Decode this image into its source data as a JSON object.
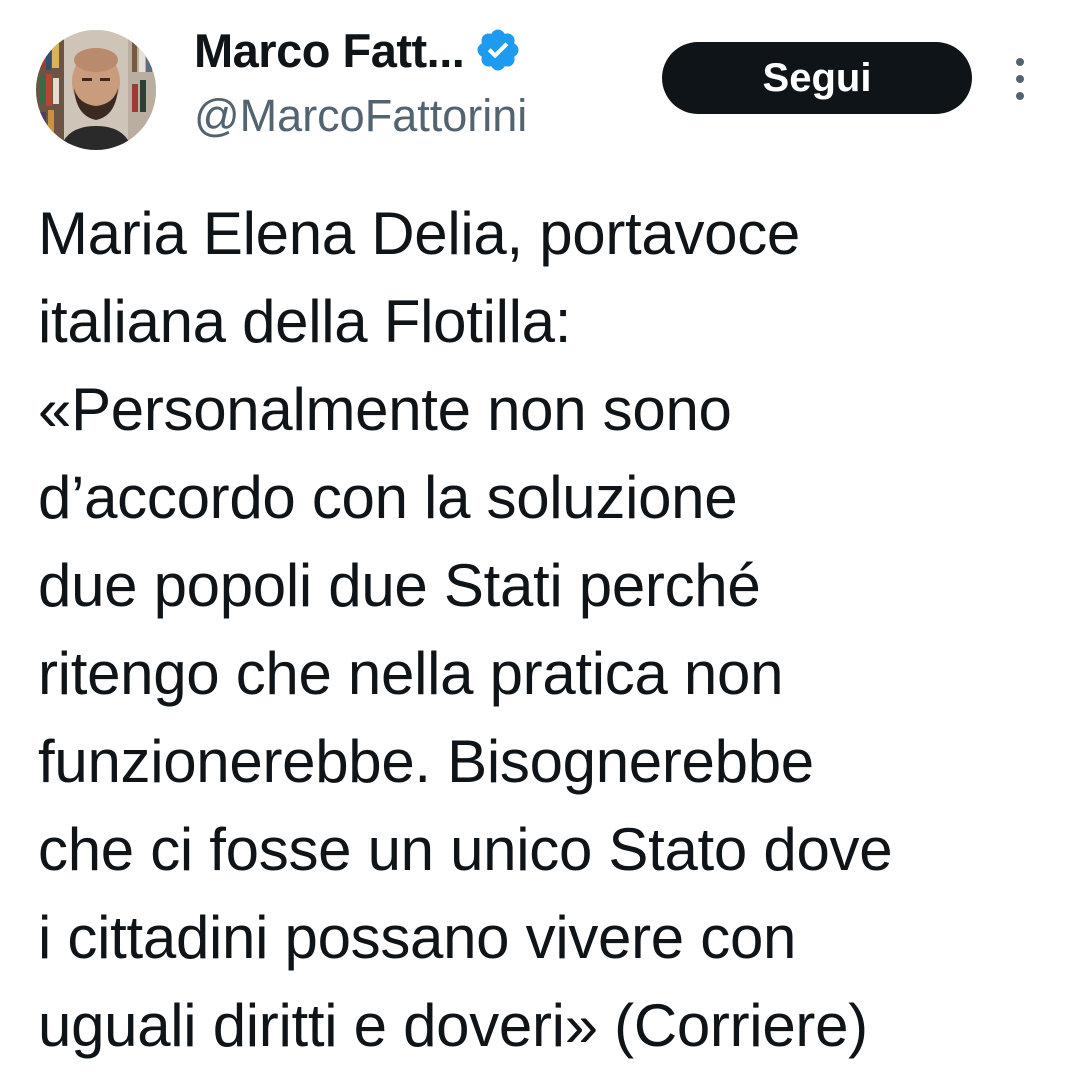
{
  "author": {
    "display_name": "Marco Fatt...",
    "handle": "@MarcoFattorini",
    "avatar_icon": "user-photo",
    "verified_icon": "verified-badge-icon"
  },
  "actions": {
    "follow_label": "Segui",
    "more_icon": "vertical-ellipsis-icon"
  },
  "tweet": {
    "lines": [
      "Maria Elena Delia, portavoce",
      "italiana della Flotilla:",
      "«Personalmente non sono",
      "d’accordo con la soluzione",
      "due popoli due Stati perché",
      "ritengo che nella pratica non",
      "funzionerebbe. Bisognerebbe",
      "che ci fosse un unico Stato dove",
      "i cittadini possano vivere con",
      "uguali diritti e doveri» (Corriere)"
    ]
  },
  "colors": {
    "text_primary": "#0f1419",
    "text_secondary": "#536471",
    "verified_blue": "#1d9bf0",
    "follow_button_bg": "#0f1419",
    "follow_button_text": "#ffffff",
    "background": "#ffffff"
  }
}
